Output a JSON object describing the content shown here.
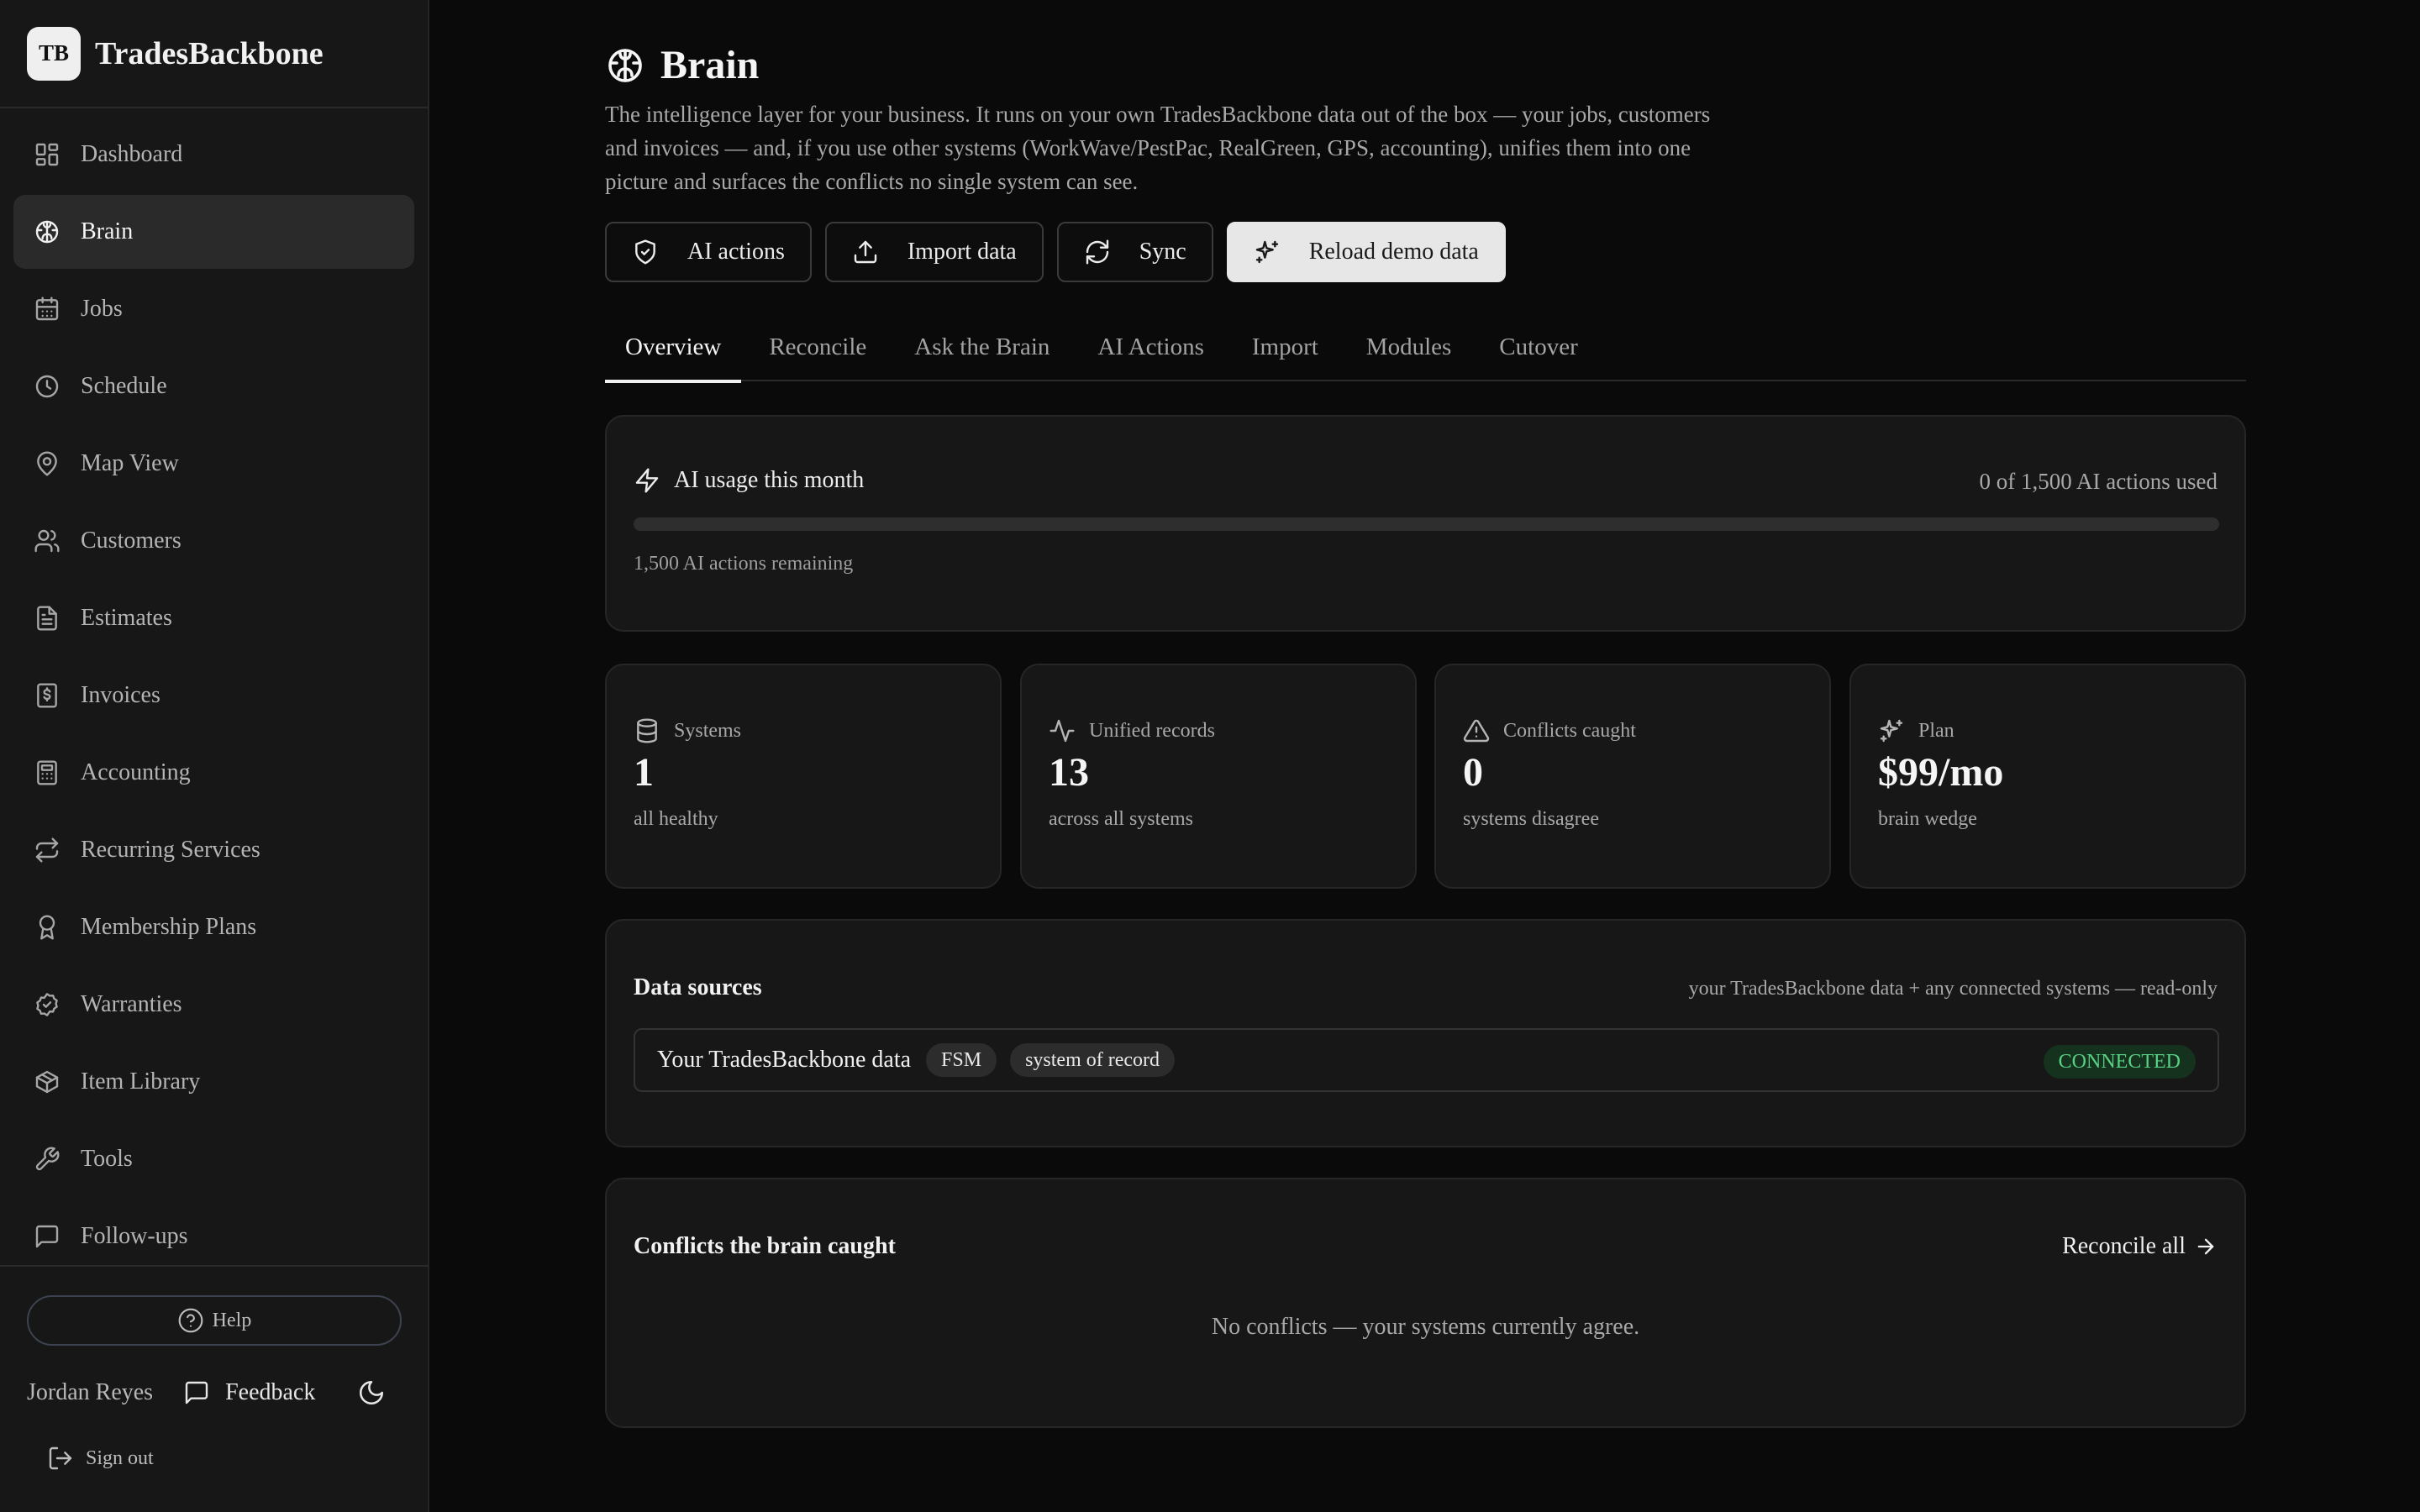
{
  "brand": {
    "logo_text": "TB",
    "name": "TradesBackbone"
  },
  "sidebar": {
    "items": [
      {
        "label": "Dashboard",
        "icon": "dashboard-icon"
      },
      {
        "label": "Brain",
        "icon": "brain-icon",
        "active": true
      },
      {
        "label": "Jobs",
        "icon": "calendar-icon"
      },
      {
        "label": "Schedule",
        "icon": "clock-icon"
      },
      {
        "label": "Map View",
        "icon": "map-pin-icon"
      },
      {
        "label": "Customers",
        "icon": "users-icon"
      },
      {
        "label": "Estimates",
        "icon": "file-text-icon"
      },
      {
        "label": "Invoices",
        "icon": "receipt-icon"
      },
      {
        "label": "Accounting",
        "icon": "calculator-icon"
      },
      {
        "label": "Recurring Services",
        "icon": "repeat-icon"
      },
      {
        "label": "Membership Plans",
        "icon": "award-icon"
      },
      {
        "label": "Warranties",
        "icon": "badge-check-icon"
      },
      {
        "label": "Item Library",
        "icon": "package-icon"
      },
      {
        "label": "Tools",
        "icon": "wrench-icon"
      },
      {
        "label": "Follow-ups",
        "icon": "message-icon"
      }
    ],
    "footer": {
      "help_label": "Help",
      "user_name": "Jordan Reyes",
      "feedback_label": "Feedback",
      "sign_out_label": "Sign out"
    }
  },
  "page": {
    "title": "Brain",
    "description": "The intelligence layer for your business. It runs on your own TradesBackbone data out of the box — your jobs, customers and invoices — and, if you use other systems (WorkWave/PestPac, RealGreen, GPS, accounting), unifies them into one picture and surfaces the conflicts no single system can see."
  },
  "actions": {
    "ai_actions": "AI actions",
    "import_data": "Import data",
    "sync": "Sync",
    "reload_demo": "Reload demo data"
  },
  "tabs": [
    "Overview",
    "Reconcile",
    "Ask the Brain",
    "AI Actions",
    "Import",
    "Modules",
    "Cutover"
  ],
  "usage": {
    "title": "AI usage this month",
    "count_text": "0 of 1,500 AI actions used",
    "used": 0,
    "limit": 1500,
    "remaining_text": "1,500 AI actions remaining"
  },
  "stats": [
    {
      "label": "Systems",
      "value": "1",
      "sub": "all healthy",
      "icon": "database-icon"
    },
    {
      "label": "Unified records",
      "value": "13",
      "sub": "across all systems",
      "icon": "activity-icon"
    },
    {
      "label": "Conflicts caught",
      "value": "0",
      "sub": "systems disagree",
      "icon": "alert-triangle-icon"
    },
    {
      "label": "Plan",
      "value": "$99/mo",
      "sub": "brain wedge",
      "icon": "sparkles-icon"
    }
  ],
  "sources": {
    "title": "Data sources",
    "note": "your TradesBackbone data + any connected systems — read-only",
    "rows": [
      {
        "name": "Your TradesBackbone data",
        "tags": [
          "FSM",
          "system of record"
        ],
        "status": "CONNECTED"
      }
    ]
  },
  "conflicts": {
    "title": "Conflicts the brain caught",
    "reconcile_label": "Reconcile all",
    "empty_text": "No conflicts — your systems currently agree."
  },
  "colors": {
    "background": "#0a0a0a",
    "card": "#171717",
    "connected": "#59d184"
  }
}
